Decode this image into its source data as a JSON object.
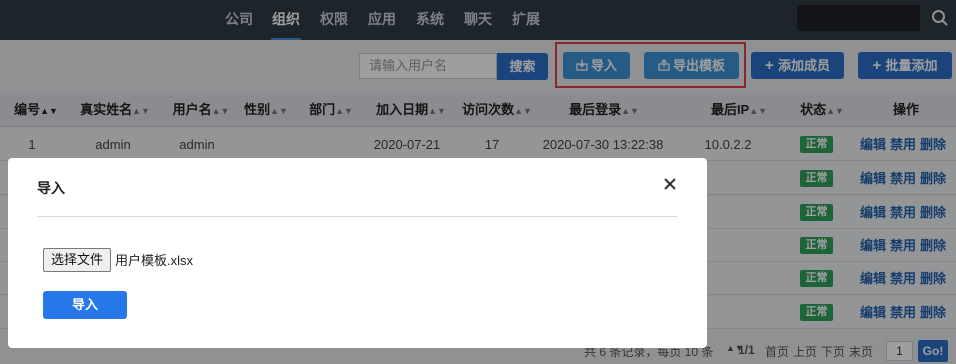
{
  "nav": {
    "items": [
      "公司",
      "组织",
      "权限",
      "应用",
      "系统",
      "聊天",
      "扩展"
    ],
    "active": "组织"
  },
  "toolbar": {
    "search_placeholder": "请输入用户名",
    "search_label": "搜索",
    "import_label": "导入",
    "export_label": "导出模板",
    "add_label": "添加成员",
    "batch_label": "批量添加"
  },
  "table": {
    "headers": [
      "编号",
      "真实姓名",
      "用户名",
      "性别",
      "部门",
      "加入日期",
      "访问次数",
      "最后登录",
      "最后IP",
      "状态",
      "操作"
    ],
    "rows": [
      {
        "id": "1",
        "real_name": "admin",
        "username": "admin",
        "gender": "",
        "dept": "",
        "join_date": "2020-07-21",
        "visits": "17",
        "last_login": "2020-07-30 13:22:38",
        "last_ip": "10.0.2.2",
        "status": "正常"
      },
      {
        "status": "正常"
      },
      {
        "status": "正常"
      },
      {
        "status": "正常"
      },
      {
        "status": "正常"
      },
      {
        "status": "正常"
      }
    ],
    "ops": [
      "编辑",
      "禁用",
      "删除"
    ]
  },
  "footer": {
    "summary": "共 6 条记录，每页 10 条",
    "page_info": "1/1",
    "first": "首页",
    "prev": "上页",
    "next": "下页",
    "last": "末页",
    "page_value": "1",
    "go_label": "Go!"
  },
  "modal": {
    "title": "导入",
    "file_button_label": "选择文件",
    "file_name": "用户模板.xlsx",
    "import_label": "导入"
  },
  "colors": {
    "topbar": "#2f3a45",
    "primary": "#2d6fc9",
    "light_button": "#3d94d6",
    "highlight": "#e23c3c",
    "status_ok": "#2fa25b",
    "modal_import": "#2678e8"
  }
}
